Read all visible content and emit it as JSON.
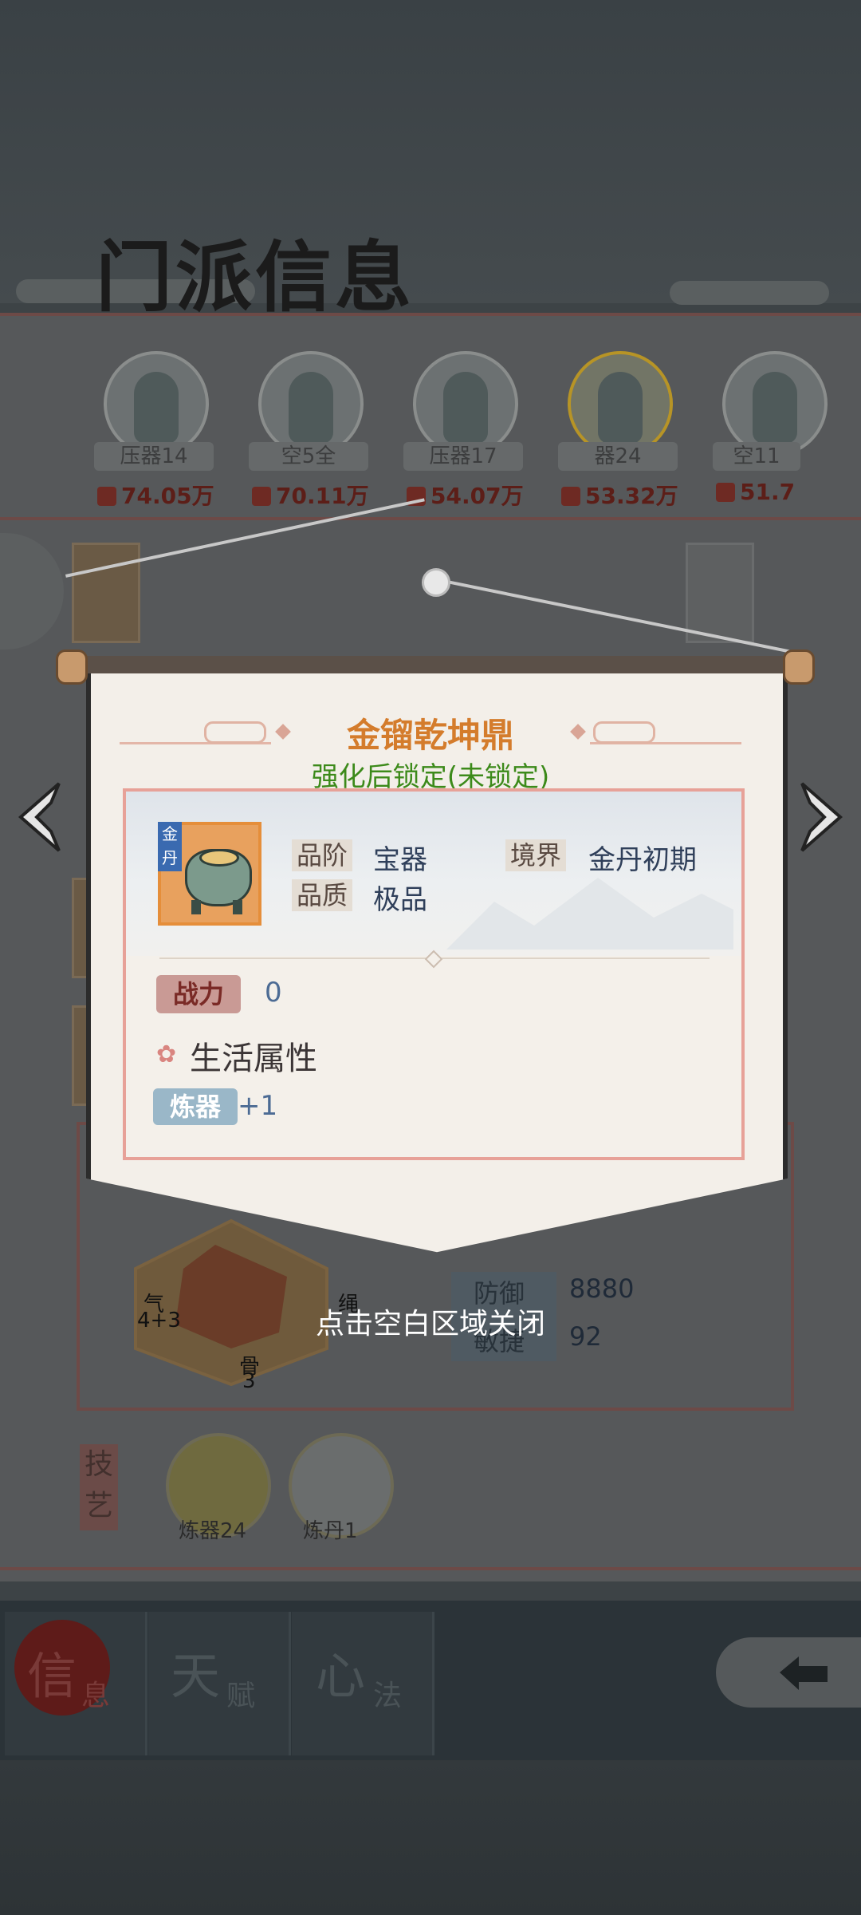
{
  "header": {
    "title": "门派信息"
  },
  "members": [
    {
      "tag": "压器14",
      "wealth": "74.05万"
    },
    {
      "tag": "空5全",
      "wealth": "70.11万"
    },
    {
      "tag": "压器17",
      "wealth": "54.07万"
    },
    {
      "tag": "器24",
      "wealth": "53.32万"
    },
    {
      "tag": "空11",
      "wealth": "51.7"
    }
  ],
  "background_stats": {
    "radar_labels": {
      "qi": "气",
      "qi_val": "4+3",
      "bone": "骨",
      "bone_val": "3",
      "extra": "绳"
    },
    "defense_label": "防御",
    "defense_value": "8880",
    "agility_label": "敏捷",
    "agility_value": "92"
  },
  "skills": {
    "section_label": "技艺",
    "items": [
      {
        "label": "炼器24"
      },
      {
        "label": "炼丹1"
      }
    ]
  },
  "tabs": [
    {
      "big": "信",
      "small": "息"
    },
    {
      "big": "天",
      "small": "赋"
    },
    {
      "big": "心",
      "small": "法"
    }
  ],
  "popup": {
    "item_name": "金镏乾坤鼎",
    "lock_status": "强化后锁定(未锁定)",
    "grade_tag": "金丹",
    "rank_label": "品阶",
    "rank_value": "宝器",
    "quality_label": "品质",
    "quality_value": "极品",
    "realm_label": "境界",
    "realm_value": "金丹初期",
    "power_label": "战力",
    "power_value": "0",
    "life_attr_title": "生活属性",
    "craft_label": "炼器",
    "craft_value": "+1"
  },
  "close_hint": "点击空白区域关闭",
  "colors": {
    "item_name": "#d47c2c",
    "lock_status": "#3c8a1a",
    "frame": "#e7a198"
  }
}
